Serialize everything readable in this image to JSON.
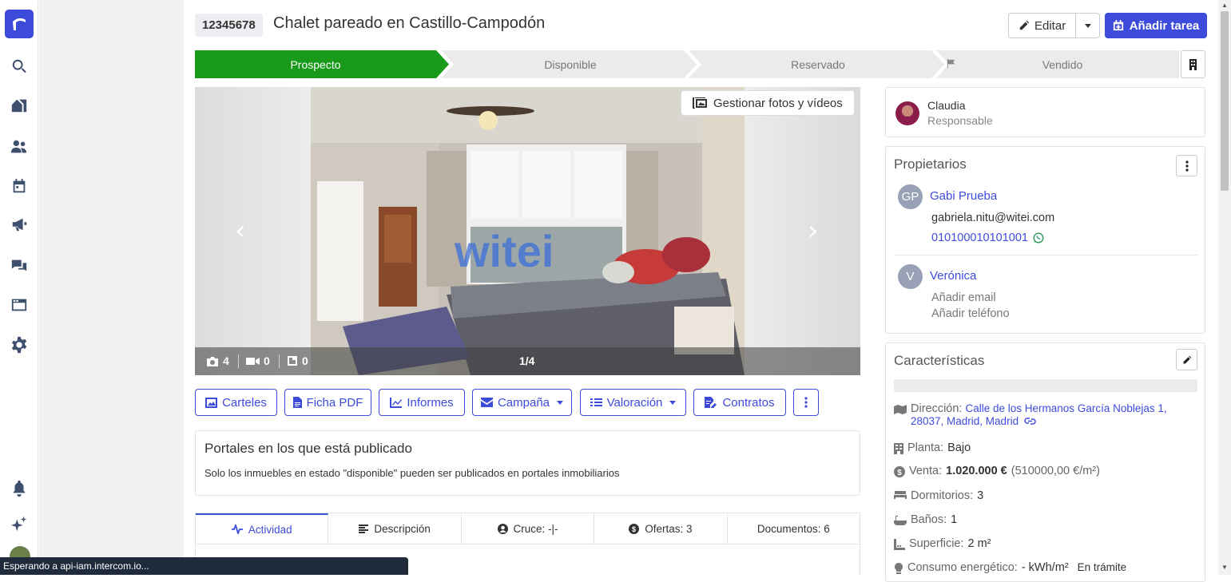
{
  "sidebar": {
    "items": [
      {
        "icon": "search-icon"
      },
      {
        "icon": "properties-icon"
      },
      {
        "icon": "contacts-icon"
      },
      {
        "icon": "calendar-icon"
      },
      {
        "icon": "megaphone-icon"
      },
      {
        "icon": "chat-icon"
      },
      {
        "icon": "browser-icon"
      },
      {
        "icon": "settings-icon"
      },
      {
        "icon": "bell-icon"
      },
      {
        "icon": "sparkles-icon"
      }
    ]
  },
  "header": {
    "reference": "12345678",
    "title": "Chalet pareado en Castillo-Campodón",
    "edit_label": "Editar",
    "add_task_label": "Añadir tarea"
  },
  "pipeline": {
    "stages": [
      {
        "label": "Prospecto",
        "active": true
      },
      {
        "label": "Disponible",
        "active": false
      },
      {
        "label": "Reservado",
        "active": false
      },
      {
        "label": "Vendido",
        "active": false
      }
    ],
    "active_color": "#1a9a1a"
  },
  "gallery": {
    "manage_label": "Gestionar fotos y vídeos",
    "photos": "4",
    "videos": "0",
    "plans": "0",
    "position": "1/4",
    "watermark": "witei"
  },
  "actions": {
    "carteles": "Carteles",
    "ficha": "Ficha PDF",
    "informes": "Informes",
    "campana": "Campaña",
    "valoracion": "Valoración",
    "contratos": "Contratos"
  },
  "portals": {
    "title": "Portales en los que está publicado",
    "text": "Solo los inmuebles en estado \"disponible\" pueden ser publicados en portales inmobiliarios"
  },
  "tabs": {
    "actividad": "Actividad",
    "descripcion": "Descripción",
    "cruce": "Cruce: -|-",
    "ofertas": "Ofertas: 3",
    "documentos": "Documentos: 6"
  },
  "responsible": {
    "name": "Claudia",
    "role": "Responsable"
  },
  "owners": {
    "title": "Propietarios",
    "list": [
      {
        "initials": "GP",
        "name": "Gabi Prueba",
        "email": "gabriela.nitu@witei.com",
        "phone": "010100010101001"
      },
      {
        "initials": "V",
        "name": "Verónica",
        "add_email": "Añadir email",
        "add_phone": "Añadir teléfono"
      }
    ]
  },
  "features": {
    "title": "Características",
    "address_label": "Dirección:",
    "address_line1": "Calle de los Hermanos García Noblejas 1,",
    "address_line2": "28037, Madrid, Madrid",
    "floor_label": "Planta:",
    "floor_value": "Bajo",
    "sale_label": "Venta:",
    "sale_value": "1.020.000 €",
    "sale_per_m2": "(510000,00 €/m²)",
    "bedrooms_label": "Dormitorios:",
    "bedrooms_value": "3",
    "baths_label": "Baños:",
    "baths_value": "1",
    "surface_label": "Superficie:",
    "surface_value": "2 m²",
    "energy_label": "Consumo energético:",
    "energy_value": "- kWh/m²",
    "energy_status": "En trámite"
  },
  "status_bar": "Esperando a api-iam.intercom.io..."
}
